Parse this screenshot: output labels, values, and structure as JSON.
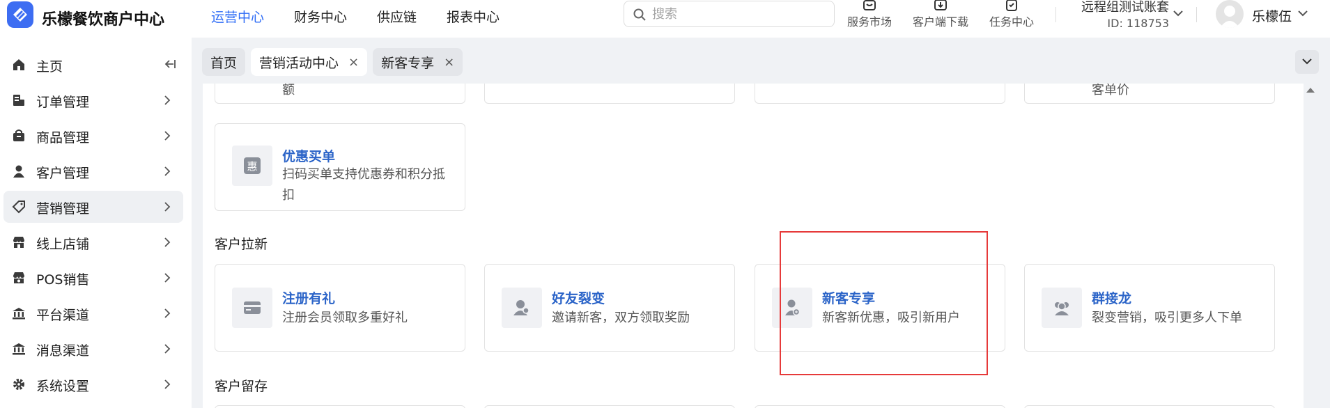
{
  "app": {
    "brand": "乐檬餐饮商户中心",
    "accent": "#2e6cf6"
  },
  "top_nav": [
    {
      "label": "运营中心",
      "active": true
    },
    {
      "label": "财务中心",
      "active": false
    },
    {
      "label": "供应链",
      "active": false
    },
    {
      "label": "报表中心",
      "active": false
    }
  ],
  "search": {
    "placeholder": "搜索",
    "value": ""
  },
  "tools": [
    {
      "label": "服务市场",
      "icon": "store-icon"
    },
    {
      "label": "客户端下载",
      "icon": "download-icon"
    },
    {
      "label": "任务中心",
      "icon": "clipboard-check-icon"
    }
  ],
  "account": {
    "name": "远程组测试账套",
    "id": "ID: 118753"
  },
  "user": {
    "name": "乐檬伍"
  },
  "sidebar": {
    "items": [
      {
        "label": "主页",
        "icon": "home-icon",
        "active": false
      },
      {
        "label": "订单管理",
        "icon": "order-icon",
        "active": false
      },
      {
        "label": "商品管理",
        "icon": "bag-icon",
        "active": false
      },
      {
        "label": "客户管理",
        "icon": "user-icon",
        "active": false
      },
      {
        "label": "营销管理",
        "icon": "tag-icon",
        "active": true
      },
      {
        "label": "线上店铺",
        "icon": "shop-icon",
        "active": false
      },
      {
        "label": "POS销售",
        "icon": "pos-icon",
        "active": false
      },
      {
        "label": "平台渠道",
        "icon": "bank-icon",
        "active": false
      },
      {
        "label": "消息渠道",
        "icon": "bank-icon",
        "active": false
      },
      {
        "label": "系统设置",
        "icon": "gear-icon",
        "active": false
      }
    ]
  },
  "tabs": [
    {
      "label": "首页",
      "closable": false,
      "active": false
    },
    {
      "label": "营销活动中心",
      "closable": true,
      "active": true
    },
    {
      "label": "新客专享",
      "closable": true,
      "active": false
    }
  ],
  "tab_close_glyph": "×",
  "partial_row": [
    {
      "desc": "额"
    },
    {
      "desc": ""
    },
    {
      "desc": ""
    },
    {
      "desc": "客单价"
    }
  ],
  "card_youhui": {
    "title": "优惠买单",
    "desc": "扫码买单支持优惠券和积分抵扣",
    "icon_char": "惠"
  },
  "sections": {
    "acquire": "客户拉新",
    "retain": "客户留存"
  },
  "acquire_cards": [
    {
      "title": "注册有礼",
      "desc": "注册会员领取多重好礼",
      "icon": "card-icon"
    },
    {
      "title": "好友裂变",
      "desc": "邀请新客，双方领取奖励",
      "icon": "users-icon"
    },
    {
      "title": "新客专享",
      "desc": "新客新优惠，吸引新用户",
      "icon": "new-user-icon"
    },
    {
      "title": "群接龙",
      "desc": "裂变营销，吸引更多人下单",
      "icon": "group-icon"
    }
  ]
}
